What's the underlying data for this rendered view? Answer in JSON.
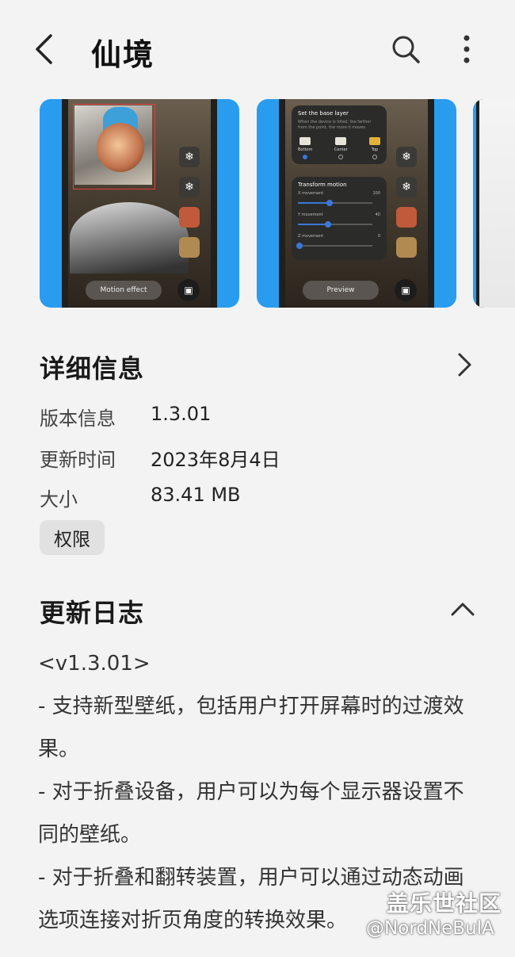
{
  "header": {
    "title": "仙境",
    "back_icon": "back-arrow-icon",
    "search_icon": "search-icon",
    "more_icon": "more-vert-icon"
  },
  "screenshots": [
    {
      "button_label": "Motion effect"
    },
    {
      "base_layer_title": "Set the base layer",
      "base_layer_desc": "When the device is tilted, the farther from the point, the more it moves.",
      "options": [
        "Bottom",
        "Center",
        "Top"
      ],
      "transform_title": "Transform motion",
      "sliders": [
        {
          "label": "X movement",
          "value": "100",
          "fraction": 0.4
        },
        {
          "label": "Y movement",
          "value": "40",
          "fraction": 0.38
        },
        {
          "label": "Z movement",
          "value": "0",
          "fraction": 0.0
        }
      ],
      "button_label": "Preview"
    }
  ],
  "details": {
    "title": "详细信息",
    "rows": [
      {
        "label": "版本信息",
        "value": "1.3.01"
      },
      {
        "label": "更新时间",
        "value": "2023年8月4日"
      },
      {
        "label": "大小",
        "value": "83.41 MB"
      }
    ],
    "permissions_label": "权限"
  },
  "changelog": {
    "title": "更新日志",
    "version": "<v1.3.01>",
    "lines": [
      "- 支持新型壁纸，包括用户打开屏幕时的过渡效果。",
      "- 对于折叠设备，用户可以为每个显示器设置不同的壁纸。",
      "- 对于折叠和翻转装置，用户可以通过动态动画选项连接对折页角度的转换效果。"
    ]
  },
  "watermark": {
    "site": "盖乐世社区",
    "user": "@NordNeBulA"
  },
  "colors": {
    "background": "#f3f3f3",
    "carousel_blue": "#2a9cf0",
    "chip_bg": "#e1e1e1"
  }
}
